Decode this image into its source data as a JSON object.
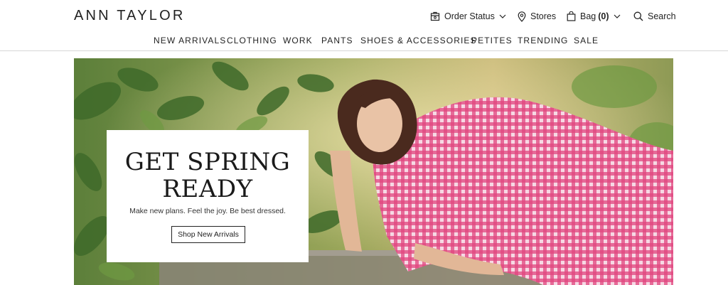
{
  "brand": {
    "logo_text": "ANN TAYLOR"
  },
  "utility": {
    "order_status": {
      "label": "Order Status",
      "icon": "order-box-icon"
    },
    "stores": {
      "label": "Stores",
      "icon": "location-pin-icon"
    },
    "bag": {
      "label": "Bag",
      "count": "(0)",
      "icon": "shopping-bag-icon"
    },
    "search": {
      "label": "Search",
      "icon": "search-icon"
    }
  },
  "nav": {
    "items": [
      {
        "label": "NEW ARRIVALS"
      },
      {
        "label": "CLOTHING"
      },
      {
        "label": "WORK"
      },
      {
        "label": "PANTS"
      },
      {
        "label": "SHOES & ACCESSORIES"
      },
      {
        "label": "PETITES"
      },
      {
        "label": "TRENDING"
      },
      {
        "label": "SALE"
      }
    ]
  },
  "hero": {
    "title_line1": "GET SPRING",
    "title_line2": "READY",
    "subtitle": "Make new plans. Feel the joy. Be best dressed.",
    "cta_label": "Shop New Arrivals"
  },
  "colors": {
    "text": "#222222",
    "divider": "#d6d6d6",
    "dress_pink": "#e0457e",
    "foliage_green": "#4f7a35"
  }
}
